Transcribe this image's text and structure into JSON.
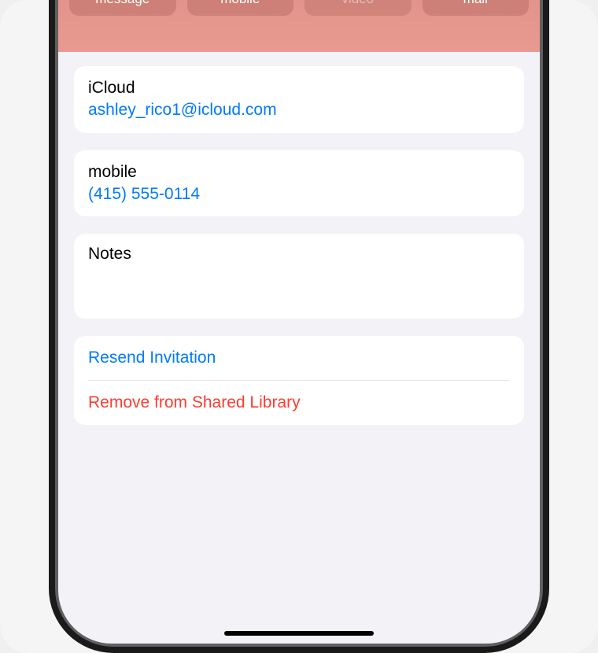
{
  "header": {
    "actions": [
      {
        "label": "message",
        "enabled": true
      },
      {
        "label": "mobile",
        "enabled": true
      },
      {
        "label": "video",
        "enabled": false
      },
      {
        "label": "mail",
        "enabled": true
      }
    ]
  },
  "fields": {
    "icloud": {
      "label": "iCloud",
      "value": "ashley_rico1@icloud.com"
    },
    "mobile": {
      "label": "mobile",
      "value": "(415) 555-0114"
    },
    "notes": {
      "label": "Notes"
    }
  },
  "actions": {
    "resend": "Resend Invitation",
    "remove": "Remove from Shared Library"
  }
}
